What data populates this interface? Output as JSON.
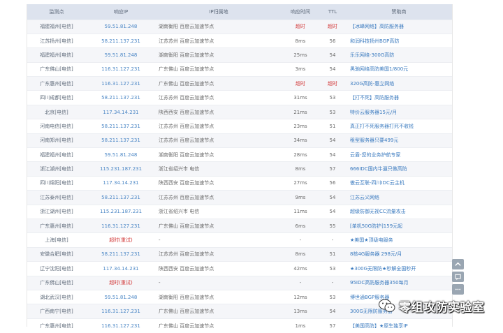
{
  "table": {
    "headers": {
      "monitor": "监测点",
      "ip": "响应IP",
      "geo": "IP归属地",
      "response_time": "响应时间",
      "ttl": "TTL",
      "sponsor": "赞助商"
    },
    "rows": [
      {
        "loc": "福建福州[电信]",
        "ip": "59.51.81.248",
        "geo": "湖南衡阳 百度云加速节点",
        "rt": "超时",
        "ttl": "超时",
        "sponsor": "【冰峰网络】高防服务器",
        "rt_timeout": true,
        "ttl_timeout": true
      },
      {
        "loc": "江苏扬州[电信]",
        "ip": "58.211.137.231",
        "geo": "江苏苏州 百度云加速节点",
        "rt": "8ms",
        "ttl": "56",
        "sponsor": "和润科技扬州BGP高防"
      },
      {
        "loc": "福建福州[电信]",
        "ip": "59.51.81.248",
        "geo": "湖南衡阳 百度云加速节点",
        "rt": "25ms",
        "ttl": "54",
        "sponsor": "乐乐网络-300G高防"
      },
      {
        "loc": "广东佛山[电信]",
        "ip": "116.31.127.231",
        "geo": "广东佛山 百度云加速节点",
        "rt": "3ms",
        "ttl": "54",
        "sponsor": "黑驰网络高防美国1/800元"
      },
      {
        "loc": "广东惠州[电信]",
        "ip": "116.31.127.231",
        "geo": "广东佛山 百度云加速节点",
        "rt": "超时",
        "ttl": "超时",
        "sponsor": "320G高防-惠立网络",
        "rt_timeout": true,
        "ttl_timeout": true
      },
      {
        "loc": "四川成都[电信]",
        "ip": "58.211.137.231",
        "geo": "江苏苏州 百度云加速节点",
        "rt": "31ms",
        "ttl": "53",
        "sponsor": "【打不死】高防服务器"
      },
      {
        "loc": "北京[电信]",
        "ip": "117.34.14.231",
        "geo": "陕西西安 百度云加速节点",
        "rt": "21ms",
        "ttl": "53",
        "sponsor": "特价云服务器15元/月"
      },
      {
        "loc": "河南电信[电信]",
        "ip": "58.211.137.231",
        "geo": "江苏苏州 百度云加速节点",
        "rt": "23ms",
        "ttl": "51",
        "sponsor": "真正打不死服务器打死不收钱"
      },
      {
        "loc": "河南郑州[电信]",
        "ip": "58.211.137.231",
        "geo": "江苏苏州 百度云加速节点",
        "rt": "34ms",
        "ttl": "54",
        "sponsor": "租型服务器只要499元"
      },
      {
        "loc": "福建福州[电信]",
        "ip": "59.51.81.248",
        "geo": "湖南衡阳 百度云加速节点",
        "rt": "28ms",
        "ttl": "54",
        "sponsor": "云盾-您的业务护航专家"
      },
      {
        "loc": "浙江湖州[电信]",
        "ip": "115.231.187.231",
        "geo": "浙江省绍兴市 电信",
        "rt": "8ms",
        "ttl": "57",
        "sponsor": "666IDC国内牛逼只做高防"
      },
      {
        "loc": "四川绵阳[电信]",
        "ip": "117.34.14.231",
        "geo": "陕西西安 百度云加速节点",
        "rt": "27ms",
        "ttl": "56",
        "sponsor": "傲云互联-四川IDC云主机"
      },
      {
        "loc": "江苏泰州[电信]",
        "ip": "58.211.137.231",
        "geo": "江苏苏州 百度云加速节点",
        "rt": "9ms",
        "ttl": "54",
        "sponsor": "江苏云义网络"
      },
      {
        "loc": "浙江湖州[电信]",
        "ip": "115.231.187.231",
        "geo": "浙江省绍兴市 电信",
        "rt": "11ms",
        "ttl": "54",
        "sponsor": "超级防御无视CC流量攻击"
      },
      {
        "loc": "广东惠州[电信]",
        "ip": "116.31.127.231",
        "geo": "广东佛山 百度云加速节点",
        "rt": "6ms",
        "ttl": "55",
        "sponsor": "[单机50G防护]159元起"
      },
      {
        "loc": "上海[电信]",
        "ip": "超时(重试)",
        "geo": "-",
        "rt": "-",
        "ttl": "-",
        "sponsor": "★美国★顶级电服务",
        "ip_timeout": true
      },
      {
        "loc": "安徽合肥[电信]",
        "ip": "58.211.137.231",
        "geo": "江苏苏州 百度云加速节点",
        "rt": "8ms",
        "ttl": "51",
        "sponsor": "8核4G服务器 298元/月"
      },
      {
        "loc": "辽宁沈阳[电信]",
        "ip": "117.34.14.231",
        "geo": "陕西西安 百度云加速节点",
        "rt": "42ms",
        "ttl": "53",
        "sponsor": "★300G无限防★秒解全国秒开"
      },
      {
        "loc": "广东佛山[电信]",
        "ip": "超时(重试)",
        "geo": "-",
        "rt": "-",
        "ttl": "-",
        "sponsor": "95IDC高防服务器350每月",
        "ip_timeout": true
      },
      {
        "loc": "湖北武汉[电信]",
        "ip": "59.51.81.248",
        "geo": "湖南衡阳 百度云加速节点",
        "rt": "12ms",
        "ttl": "53",
        "sponsor": "博世通BGP服务器"
      },
      {
        "loc": "广西南宁[电信]",
        "ip": "116.31.127.231",
        "geo": "广东佛山 百度云加速节点",
        "rt": "13ms",
        "ttl": "54",
        "sponsor": "300G无限防服务器"
      },
      {
        "loc": "广东惠州[电信]",
        "ip": "116.31.127.231",
        "geo": "广东佛山 百度云加速节点",
        "rt": "1ms",
        "ttl": "57",
        "sponsor": "【美国高防】★原生独享IP"
      }
    ]
  },
  "watermark": {
    "text": "零组攻防实验室",
    "icon": "wechat-icon"
  },
  "side_buttons": [
    "scroll-top-icon",
    "feedback-icon",
    "more-icon"
  ],
  "colors": {
    "header_bg": "#dde3ee",
    "ip_blue": "#4a86c5",
    "timeout_red": "#d23a3a",
    "sponsor_link": "#3a7abf"
  }
}
